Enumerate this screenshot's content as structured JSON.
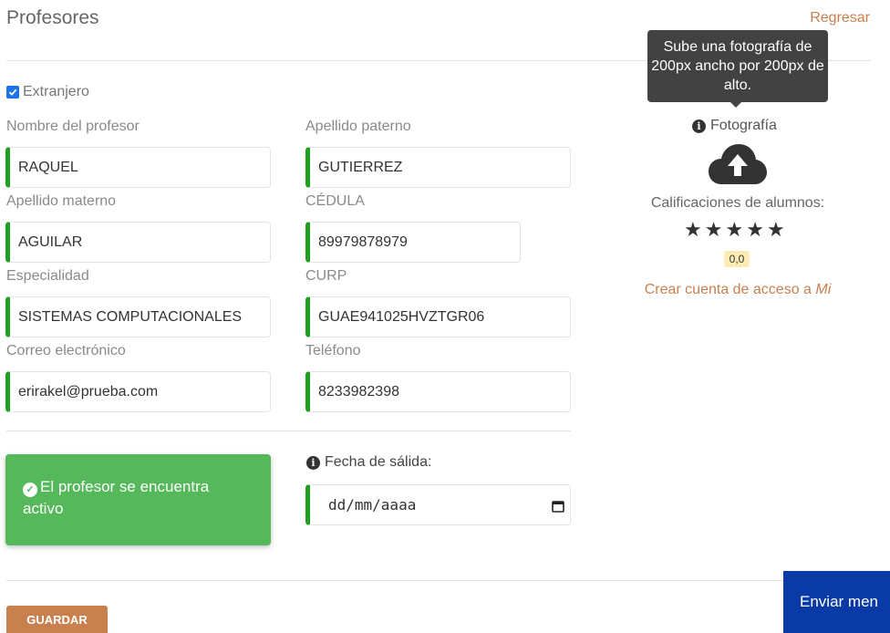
{
  "header": {
    "title": "Profesores",
    "back_label": "Regresar"
  },
  "form": {
    "foreign_label": "Extranjero",
    "foreign_checked": true,
    "fields": {
      "first_name": {
        "label": "Nombre del profesor",
        "value": "RAQUEL"
      },
      "last_name_paternal": {
        "label": "Apellido paterno",
        "value": "GUTIERREZ"
      },
      "last_name_maternal": {
        "label": "Apellido materno",
        "value": "AGUILAR"
      },
      "cedula": {
        "label": "CÉDULA",
        "value": "89979878979"
      },
      "specialty": {
        "label": "Especialidad",
        "value": "SISTEMAS COMPUTACIONALES"
      },
      "curp": {
        "label": "CURP",
        "value": "GUAE941025HVZTGR06"
      },
      "email": {
        "label": "Correo electrónico",
        "value": "erirakel@prueba.com"
      },
      "phone": {
        "label": "Teléfono",
        "value": "8233982398"
      }
    },
    "exit_date": {
      "label": "Fecha de sálida:",
      "placeholder": "dd/mm/aaaa"
    },
    "status_text": "El profesor se encuentra activo",
    "save_label": "GUARDAR"
  },
  "profile": {
    "tooltip": "Sube una fotografía de 200px ancho por 200px de alto.",
    "photo_label": "Fotografía",
    "ratings_label": "Calificaciones de alumnos:",
    "rating_stars": 5,
    "rating_value": "0,0",
    "account_link_prefix": "Crear cuenta de acceso a",
    "account_link_emph": "Mi"
  },
  "chat": {
    "send_label": "Enviar men"
  },
  "colors": {
    "accent": "#c8804f",
    "valid_border": "#1fa11f",
    "success": "#55b85a",
    "chat": "#0a3aa6",
    "tooltip": "#424242"
  }
}
